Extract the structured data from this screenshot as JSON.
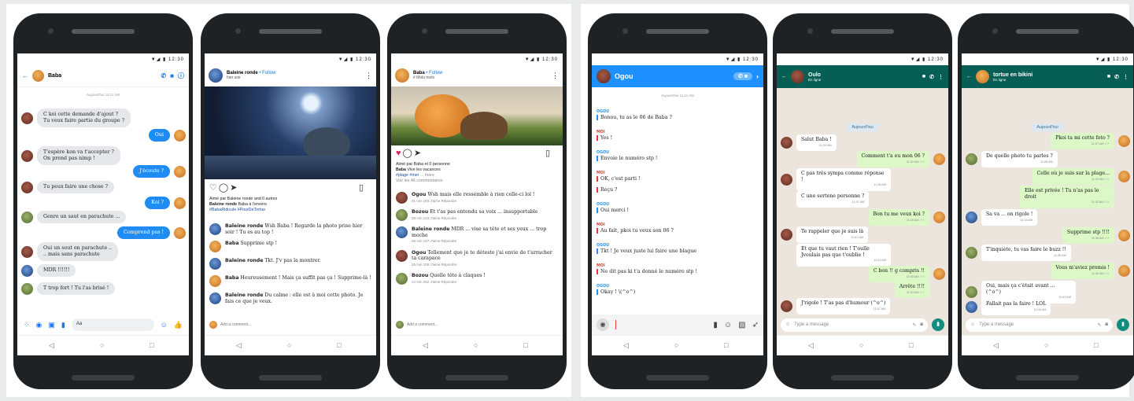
{
  "status_time": "12:30",
  "nav": {
    "back": "◁",
    "home": "○",
    "recent": "□"
  },
  "messenger": {
    "contact": "Baba",
    "time": "Aujourd'hui 11:11 AM",
    "composer": "Aa",
    "messages": [
      {
        "text": "C koi cette demande d'ajout ?\nTu veux faire partie du groupe ?"
      },
      {
        "text": "Oui"
      },
      {
        "text": "T'espère kon va t'accepter ?\nOn prend pas nimp !"
      },
      {
        "text": "J'écoute ?"
      },
      {
        "text": "Tu peux faire une chose ?"
      },
      {
        "text": "Koi ?"
      },
      {
        "text": "Genre un saut en parachute ..."
      },
      {
        "text": "Comprend pas !"
      },
      {
        "text": "Oui un sout en parachute ..\n.. mais sans parachute"
      },
      {
        "text": "MDR !!!!!!"
      },
      {
        "text": "T trop fort ! Tu l'as brisé !"
      }
    ]
  },
  "insta1": {
    "author": "Baleine ronde",
    "follow": "• Follow",
    "sub": "hier soir",
    "liked": "Aimé par Baleine ronde and 0 autres",
    "caption_author": "Baleine ronde",
    "caption": "Baba à l'envers",
    "tags": "#BabaRidicule #PourDeTortue",
    "add": "Add a comment...",
    "comments": [
      {
        "author": "Baleine ronde",
        "text": "Wsh Baba ! Regarde la photo prise hier soir ! Tu es au top !"
      },
      {
        "author": "Baba",
        "text": "Supprime stp !"
      },
      {
        "author": "Baleine ronde",
        "text": "Tkt. J'v pas la montrer."
      },
      {
        "author": "Baba",
        "text": "Heureusement ! Mais ça suffit pas ça ! Supprime-là !"
      },
      {
        "author": "Baleine ronde",
        "text": "Du calme : elle est à moi cette photo. Je fais ce que je veux."
      }
    ]
  },
  "insta2": {
    "author": "Baba",
    "follow": "• Follow",
    "sub": "# Molo molo",
    "liked": "Aimé par Baba et 0 personne",
    "caption_author": "Baba",
    "caption": "Vive les vacances",
    "tags": "#plage #mer",
    "more": "... more",
    "viewall": "Voir les 46 commentaires",
    "add": "Add a comment...",
    "comments": [
      {
        "author": "Ogou",
        "text": "Wsh mais elle ressemble à rien celle-ci lol !",
        "stats": "31 min      103 J'aime      Répondre"
      },
      {
        "author": "Bozou",
        "text": "Et t'as pas entendu sa voix ... insupportable",
        "stats": "28 min      143 J'aime      Répondre"
      },
      {
        "author": "Baleine ronde",
        "text": "MDR ... vise sa tête et ses yeux ... trop moche",
        "stats": "26 min      127 J'aime      Répondre"
      },
      {
        "author": "Ogou",
        "text": "Tellement que je te déteste j'ai envie de t'arracher ta carapace",
        "stats": "25 min      109 J'aime      Répondre"
      },
      {
        "author": "Bozou",
        "text": "Quelle tête à claques !",
        "stats": "14 min      252 J'aime      Répondre"
      }
    ]
  },
  "snap": {
    "contact": "Ogou",
    "time": "Aujourd'hui 11:11 AM",
    "lines": [
      {
        "who": "OGOU",
        "text": "Bonou, tu as le 06 de Baba ?"
      },
      {
        "who": "MOI",
        "text": "Yes !"
      },
      {
        "who": "OGOU",
        "text": "Envoie le numéro stp !"
      },
      {
        "who": "MOI",
        "text": "OK, c'est parti !"
      },
      {
        "who": "",
        "text": "Reçu ?"
      },
      {
        "who": "OGOU",
        "text": "Oui merci !"
      },
      {
        "who": "MOI",
        "text": "Au fait, pkoi tu veux son 06 ?"
      },
      {
        "who": "OGOU",
        "text": "Tkt ! Je veux juste lui faire une blague"
      },
      {
        "who": "MOI",
        "text": "Ne dit pas ki t'a donné le numéro stp !"
      },
      {
        "who": "OGOU",
        "text": "Okay ! \\(^o^)"
      }
    ]
  },
  "wa1": {
    "contact": "Oulo",
    "online": "En ligne",
    "day": "Aujourd'hui",
    "placeholder": "Type a message",
    "msgs": [
      {
        "text": "Salut Baba !",
        "tm": "11:29 AM"
      },
      {
        "text": "Comment t'a eu mon 06 ?",
        "tm": "11:32 AM ✓✓"
      },
      {
        "text": "C pas très sympa comme réponse !",
        "tm": "11:36 AM"
      },
      {
        "text": "C une sertene personne ?",
        "tm": "11:37 AM"
      },
      {
        "text": "Bon tu me veux koi ?",
        "tm": "11:39 AM ✓✓"
      },
      {
        "text": "Te rappeler que je suis là",
        "tm": "11:42 AM"
      },
      {
        "text": "Et que tu vaut rien ! T'oulle Jvoulais pas que t'oublie !",
        "tm": "11:43 AM"
      },
      {
        "text": "C bon !! g compris !!",
        "tm": "11:48 AM ✓✓"
      },
      {
        "text": "Arrête !!!!",
        "tm": "11:50 AM ✓✓"
      },
      {
        "text": "J'rigole ! T'as pas d'humour (^o^)",
        "tm": "11:57 AM"
      }
    ]
  },
  "wa2": {
    "contact": "tortue en bikini",
    "online": "En ligne",
    "day": "Aujourd'hui",
    "placeholder": "Type a message",
    "msgs": [
      {
        "text": "Pkoi ta mi cette foto ?",
        "tm": "11:27 AM ✓✓"
      },
      {
        "text": "De quelle photo tu parles ?",
        "tm": "11:28 AM"
      },
      {
        "text": "Celle où je suis sur la plage...",
        "tm": "11:29 AM ✓✓"
      },
      {
        "text": "Elle est privée ! Tu n'as pas le droit",
        "tm": "11:32 AM ✓✓"
      },
      {
        "text": "Sa va ... on rigole !",
        "tm": "11:34 AM"
      },
      {
        "text": "Supprime stp !!!!",
        "tm": "11:38 AM ✓✓"
      },
      {
        "text": "T'inquiète, tu vas faire le buzz !!",
        "tm": "11:39 AM"
      },
      {
        "text": "Vous m'aviez promis !",
        "tm": "11:40 AM ✓✓"
      },
      {
        "text": "Oui, mais ça c'était avant ... (^o^)",
        "tm": "11:43 AM"
      },
      {
        "text": "Fallait pas la faire ! LOL",
        "tm": "11:45 AM"
      }
    ]
  }
}
